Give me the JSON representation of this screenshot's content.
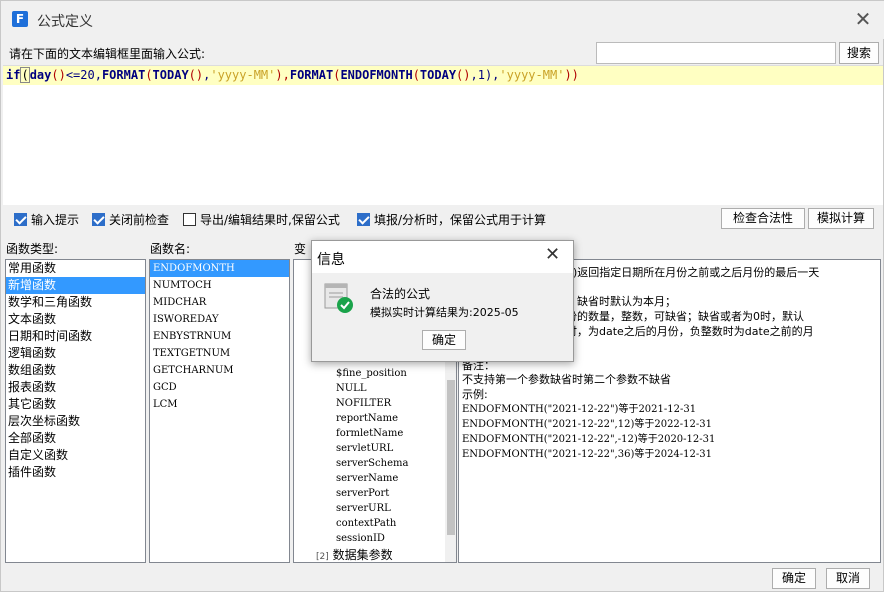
{
  "window": {
    "title": "公式定义",
    "app_icon_letter": "F"
  },
  "prompt": {
    "label": "请在下面的文本编辑框里面输入公式:"
  },
  "search": {
    "value": "",
    "button_label": "搜索"
  },
  "editor": {
    "tokens": [
      {
        "t": "if",
        "c": "kw"
      },
      {
        "t": "(",
        "c": "brk"
      },
      {
        "t": "day",
        "c": "kw"
      },
      {
        "t": "()",
        "c": "op"
      },
      {
        "t": "<=20,",
        "c": "num"
      },
      {
        "t": "FORMAT",
        "c": "kw"
      },
      {
        "t": "(",
        "c": "op"
      },
      {
        "t": "TODAY",
        "c": "kw"
      },
      {
        "t": "()",
        "c": "op"
      },
      {
        "t": ",",
        "c": "num"
      },
      {
        "t": "'yyyy-MM'",
        "c": "str"
      },
      {
        "t": "),",
        "c": "op"
      },
      {
        "t": "FORMAT",
        "c": "kw"
      },
      {
        "t": "(",
        "c": "op"
      },
      {
        "t": "ENDOFMONTH",
        "c": "kw"
      },
      {
        "t": "(",
        "c": "op"
      },
      {
        "t": "TODAY",
        "c": "kw"
      },
      {
        "t": "()",
        "c": "op"
      },
      {
        "t": ",1),",
        "c": "num"
      },
      {
        "t": "'yyyy-MM'",
        "c": "str"
      },
      {
        "t": "))",
        "c": "op"
      }
    ]
  },
  "options": {
    "input_hint": {
      "label": "输入提示",
      "checked": true
    },
    "check_before_close": {
      "label": "关闭前检查",
      "checked": true
    },
    "keep_on_export": {
      "label": "导出/编辑结果时,保留公式",
      "checked": false
    },
    "keep_on_fill": {
      "label": "填报/分析时，保留公式用于计算",
      "checked": true
    },
    "validate_button": "检查合法性",
    "simulate_button": "模拟计算"
  },
  "labels": {
    "func_type": "函数类型:",
    "func_name": "函数名:",
    "variables": "变"
  },
  "categories": [
    "常用函数",
    "新增函数",
    "数学和三角函数",
    "文本函数",
    "日期和时间函数",
    "逻辑函数",
    "数组函数",
    "报表函数",
    "其它函数",
    "层次坐标函数",
    "全部函数",
    "自定义函数",
    "插件函数"
  ],
  "selected_category_index": 1,
  "functions": [
    "ENDOFMONTH",
    "NUMTOCH",
    "MIDCHAR",
    "ISWOREDAY",
    "ENBYSTRNUM",
    "TEXTGETNUM",
    "GETCHARNUM",
    "GCD",
    "LCM"
  ],
  "selected_function_index": 0,
  "variables": [
    "$fine_position",
    "NULL",
    "NOFILTER",
    "reportName",
    "formletName",
    "servletURL",
    "serverSchema",
    "serverName",
    "serverPort",
    "serverURL",
    "contextPath",
    "sessionID"
  ],
  "variable_group": {
    "icon_label": "[2]",
    "label": "数据集参数"
  },
  "description": {
    "lines": [
      "mber)返回指定日期所在月份之前或之后月份的最后一天",
      "缺省；缺省时默认为本月；",
      "后月份的数量，整数，可缺省；缺省或者为0时，默认",
      "整数时，为date之后的月份，负整数时为date之前的月",
      "备注：",
      "不支持第一个参数缺省时第二个参数不缺省",
      "示例:",
      "ENDOFMONTH(\"2021-12-22\")等于2021-12-31",
      "ENDOFMONTH(\"2021-12-22\",12)等于2022-12-31",
      "ENDOFMONTH(\"2021-12-22\",-12)等于2020-12-31",
      "ENDOFMONTH(\"2021-12-22\",36)等于2024-12-31"
    ]
  },
  "footer": {
    "ok_label": "确定",
    "cancel_label": "取消"
  },
  "dialog": {
    "title": "信息",
    "message": "合法的公式",
    "result": "模拟实时计算结果为:2025-05",
    "ok_label": "确定"
  }
}
